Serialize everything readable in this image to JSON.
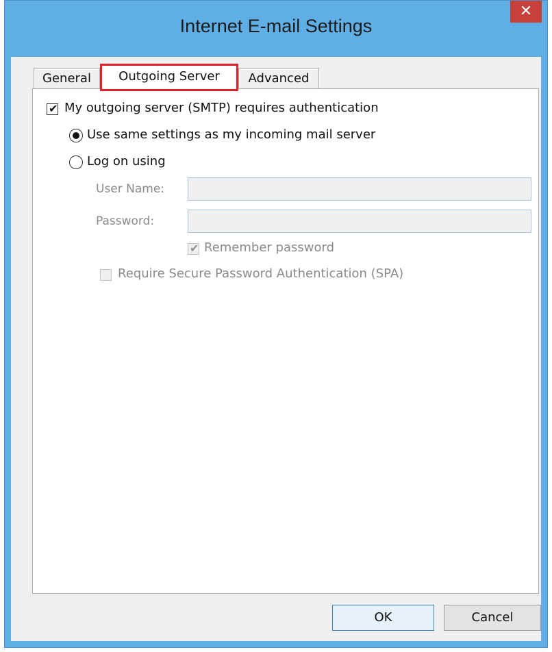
{
  "window": {
    "title": "Internet E-mail Settings",
    "close_glyph": "✕"
  },
  "tabs": [
    {
      "label": "General",
      "active": false
    },
    {
      "label": "Outgoing Server",
      "active": true
    },
    {
      "label": "Advanced",
      "active": false
    }
  ],
  "outgoing": {
    "requires_auth_label": "My outgoing server (SMTP) requires authentication",
    "requires_auth_checked": true,
    "use_same_label": "Use same settings as my incoming mail server",
    "use_same_selected": true,
    "log_on_label": "Log on using",
    "log_on_selected": false,
    "user_name_label": "User Name:",
    "user_name_value": "",
    "password_label": "Password:",
    "password_value": "",
    "remember_password_label": "Remember password",
    "remember_password_checked": true,
    "spa_label": "Require Secure Password Authentication (SPA)",
    "spa_checked": false
  },
  "buttons": {
    "ok": "OK",
    "cancel": "Cancel"
  },
  "colors": {
    "title_bar": "#60aee6",
    "close_button": "#c7413a",
    "tab_highlight": "#e2202c"
  },
  "icons": {
    "close": "close-icon",
    "check": "checkmark-icon",
    "radio": "radio-dot-icon"
  }
}
